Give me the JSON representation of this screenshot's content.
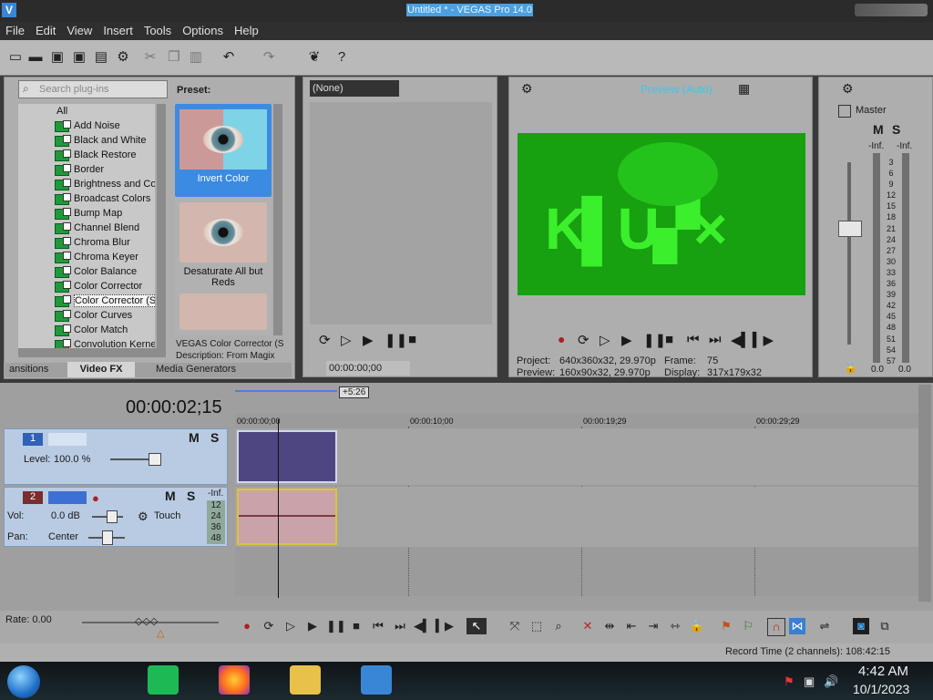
{
  "window": {
    "title": "Untitled * - VEGAS Pro 14.0"
  },
  "menu": [
    "File",
    "Edit",
    "View",
    "Insert",
    "Tools",
    "Options",
    "Help"
  ],
  "plugins": {
    "search_placeholder": "Search plug-ins",
    "root": "All",
    "items": [
      "Add Noise",
      "Black and White",
      "Black Restore",
      "Border",
      "Brightness and Co",
      "Broadcast Colors",
      "Bump Map",
      "Channel Blend",
      "Chroma Blur",
      "Chroma Keyer",
      "Color Balance",
      "Color Corrector",
      "Color Corrector (S",
      "Color Curves",
      "Color Match",
      "Convolution Kerne"
    ],
    "selected_index": 12,
    "preset_title": "Preset:",
    "presets": [
      "Invert Color",
      "Desaturate All but Reds"
    ],
    "description_line1": "VEGAS Color Corrector (S",
    "description_line2": "Description: From Magix"
  },
  "tabs": [
    "ansitions",
    "Video FX",
    "Media Generators"
  ],
  "active_tab": "Video FX",
  "trimmer": {
    "dropdown": "(None)",
    "timecode": "00:00:00;00"
  },
  "preview": {
    "mode": "Preview (Auto)",
    "project_label": "Project:",
    "project_value": "640x360x32, 29.970p",
    "preview_label": "Preview:",
    "preview_value": "160x90x32, 29.970p",
    "frame_label": "Frame:",
    "frame_value": "75",
    "display_label": "Display:",
    "display_value": "317x179x32"
  },
  "master": {
    "title": "Master",
    "m": "M",
    "s": "S",
    "inf_left": "-Inf.",
    "inf_right": "-Inf.",
    "scale": [
      "3",
      "6",
      "9",
      "12",
      "15",
      "18",
      "21",
      "24",
      "27",
      "30",
      "33",
      "36",
      "39",
      "42",
      "45",
      "48",
      "51",
      "54",
      "57"
    ],
    "bottom_left": "0.0",
    "bottom_right": "0.0"
  },
  "timeline": {
    "timecode": "00:00:02;15",
    "region_length": "+5:26",
    "ruler": [
      "00:00:00;00",
      "00:00:10;00",
      "00:00:19;29",
      "00:00:29;29"
    ],
    "video_track": {
      "number": "1",
      "level_label": "Level:",
      "level_value": "100.0 %",
      "m": "M",
      "s": "S"
    },
    "audio_track": {
      "number": "2",
      "vol_label": "Vol:",
      "vol_value": "0.0 dB",
      "pan_label": "Pan:",
      "pan_value": "Center",
      "automation": "Touch",
      "m": "M",
      "s": "S",
      "meter_top": "-Inf.",
      "meter_scale": [
        "12",
        "24",
        "36",
        "48"
      ]
    }
  },
  "transport": {
    "rate": "Rate: 0.00"
  },
  "status": {
    "record_time": "Record Time (2 channels): 108:42:15"
  },
  "taskbar": {
    "time": "4:42 AM",
    "date": "10/1/2023"
  },
  "colors": {
    "preview_green": "#17a010",
    "video_clip": "#4e4680",
    "audio_clip": "#c9a3a9",
    "title_highlight": "#4aa0e0"
  }
}
